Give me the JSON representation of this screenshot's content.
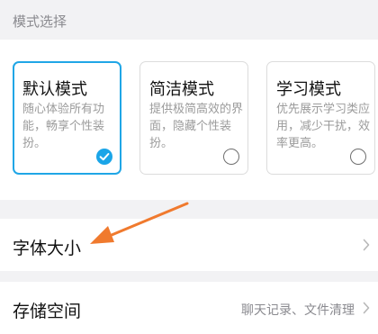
{
  "section_header": "模式选择",
  "modes": [
    {
      "title": "默认模式",
      "description": "随心体验所有功能，畅享个性装扮。",
      "selected": true
    },
    {
      "title": "简洁模式",
      "description": "提供极简高效的界面，隐藏个性装扮。",
      "selected": false
    },
    {
      "title": "学习模式",
      "description": "优先展示学习类应用，减少干扰，效率更高。",
      "selected": false
    }
  ],
  "settings": {
    "font_size": {
      "label": "字体大小",
      "value": ""
    },
    "storage": {
      "label": "存储空间",
      "value": "聊天记录、文件清理"
    }
  },
  "colors": {
    "accent": "#1aa5e8",
    "annotation_arrow": "#f07a2e"
  },
  "icons": {
    "chevron": "chevron-right-icon",
    "check": "check-icon",
    "radio": "radio-empty-icon"
  }
}
